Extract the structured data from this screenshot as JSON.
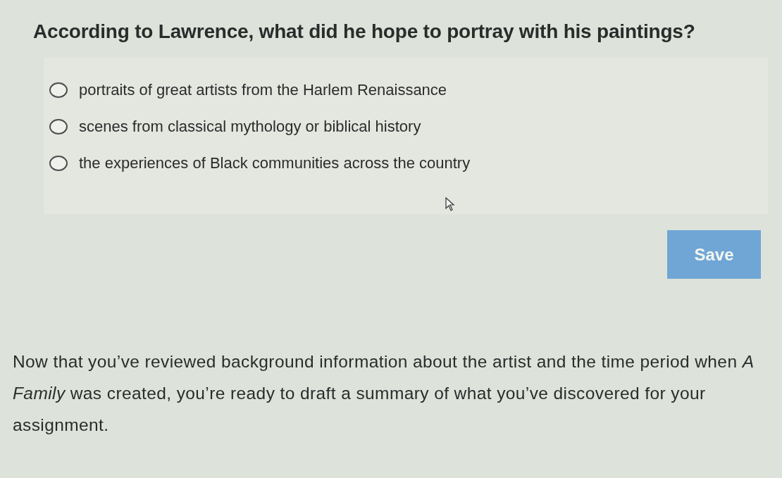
{
  "question": "According to Lawrence, what did he hope to portray with his paintings?",
  "options": [
    {
      "label": "portraits of great artists from the Harlem Renaissance",
      "selected": false
    },
    {
      "label": "scenes from classical mythology or biblical history",
      "selected": false
    },
    {
      "label": "the experiences of Black communities across the country",
      "selected": false
    }
  ],
  "save_button": "Save",
  "paragraph": "Now that you’ve reviewed background information about the artist and the time period when *A Family* was created, you’re ready to draft a summary of what you’ve discovered for your assignment."
}
